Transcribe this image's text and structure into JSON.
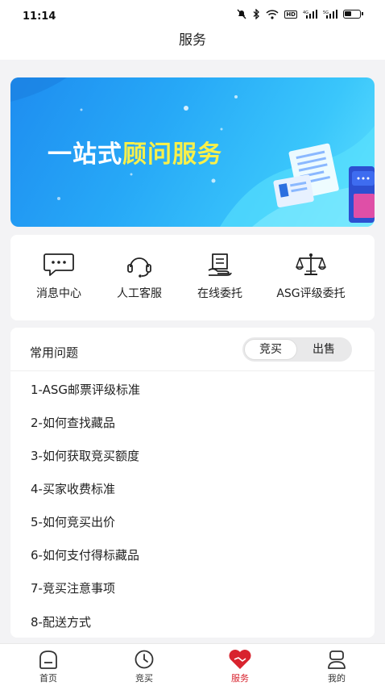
{
  "status_bar": {
    "time": "11:14",
    "network_badge": "HD",
    "signal_1": "⁴ᴳ",
    "signal_2": "⁵ᴳ"
  },
  "header": {
    "title": "服务"
  },
  "banner": {
    "text_white": "一站式",
    "text_yellow": "顾问服务"
  },
  "quick_actions": [
    {
      "label": "消息中心",
      "icon": "message-icon"
    },
    {
      "label": "人工客服",
      "icon": "headset-icon"
    },
    {
      "label": "在线委托",
      "icon": "document-hand-icon"
    },
    {
      "label": "ASG评级委托",
      "icon": "scale-icon"
    }
  ],
  "faq": {
    "title": "常用问题",
    "tabs": [
      {
        "label": "竞买",
        "selected": true
      },
      {
        "label": "出售",
        "selected": false
      }
    ],
    "items": [
      "1-ASG邮票评级标准",
      "2-如何查找藏品",
      "3-如何获取竞买额度",
      "4-买家收费标准",
      "5-如何竞买出价",
      "6-如何支付得标藏品",
      "7-竞买注意事项",
      "8-配送方式"
    ]
  },
  "tabbar": {
    "items": [
      {
        "label": "首页",
        "icon": "home-icon",
        "active": false
      },
      {
        "label": "竞买",
        "icon": "clock-icon",
        "active": false
      },
      {
        "label": "服务",
        "icon": "heart-handshake-icon",
        "active": true
      },
      {
        "label": "我的",
        "icon": "user-icon",
        "active": false
      }
    ]
  },
  "colors": {
    "accent": "#d8232e",
    "banner_blue": "#27a9f7",
    "banner_highlight": "#f8f04a"
  }
}
